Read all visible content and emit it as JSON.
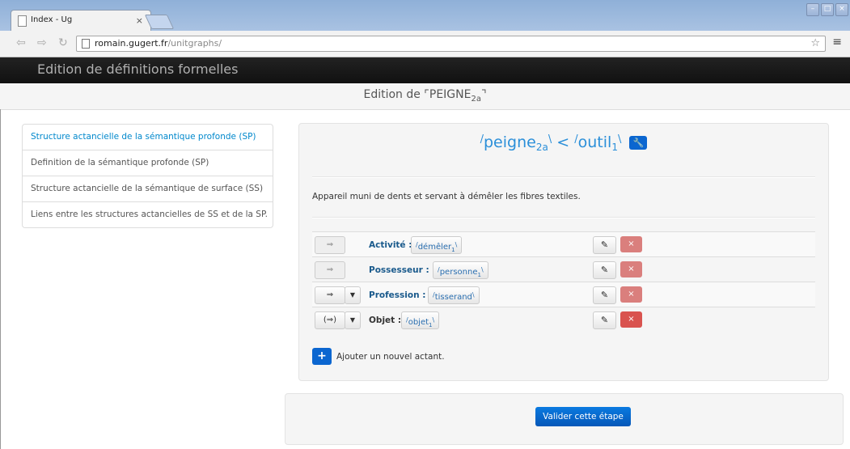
{
  "browser": {
    "tab_title": "Index - Ug",
    "tab_close": "×",
    "url_host": "romain.gugert.fr",
    "url_path": "/unitgraphs/",
    "back_icon": "back-arrow-icon",
    "forward_icon": "forward-arrow-icon",
    "reload_icon": "reload-icon",
    "star_icon": "star-icon",
    "menu_icon": "menu-icon",
    "window_buttons": [
      "–",
      "□",
      "×"
    ]
  },
  "navbar": {
    "brand": "Edition de définitions formelles"
  },
  "stage": {
    "title_prefix": "Edition de ",
    "open_quote": "⌜",
    "lexie": "PEIGNE",
    "lexie_sub": "2a",
    "close_quote": "⌝"
  },
  "leftnav": {
    "items": [
      {
        "label": "Structure actancielle de la sémantique profonde (SP)",
        "active": true
      },
      {
        "label": "Definition de la sémantique profonde (SP)",
        "active": false
      },
      {
        "label": "Structure actancielle de la sémantique de surface (SS)",
        "active": false
      },
      {
        "label": "Liens entre les structures actancielles de SS et de la SP.",
        "active": false
      }
    ]
  },
  "definition": {
    "heading": {
      "left_word": "peigne",
      "left_sub": "2a",
      "operator": "<",
      "right_word": "outil",
      "right_sub": "1"
    },
    "text": "Appareil muni de dents et servant à démêler les fibres textiles."
  },
  "actants": [
    {
      "arrow": "⇒",
      "has_dropdown": false,
      "label": "Activité :",
      "value": "démêler",
      "value_sub": "1",
      "delete_faded": true
    },
    {
      "arrow": "⇒",
      "has_dropdown": false,
      "label": "Possesseur :",
      "value": "personne",
      "value_sub": "1",
      "delete_faded": true
    },
    {
      "arrow": "⇒",
      "has_dropdown": true,
      "label": "Profession :",
      "value": "tisserand",
      "value_sub": "",
      "delete_faded": true
    },
    {
      "arrow": "(⇒)",
      "has_dropdown": true,
      "label": "Objet :",
      "value": "objet",
      "value_sub": "1",
      "delete_faded": false
    }
  ],
  "add_actant": {
    "icon": "+",
    "label": "Ajouter un nouvel actant."
  },
  "footer": {
    "validate_label": "Valider cette étape"
  },
  "colors": {
    "link_blue": "#2b8fd9",
    "primary": "#0b66d0",
    "danger": "#d9534f",
    "navbar": "#111111"
  }
}
